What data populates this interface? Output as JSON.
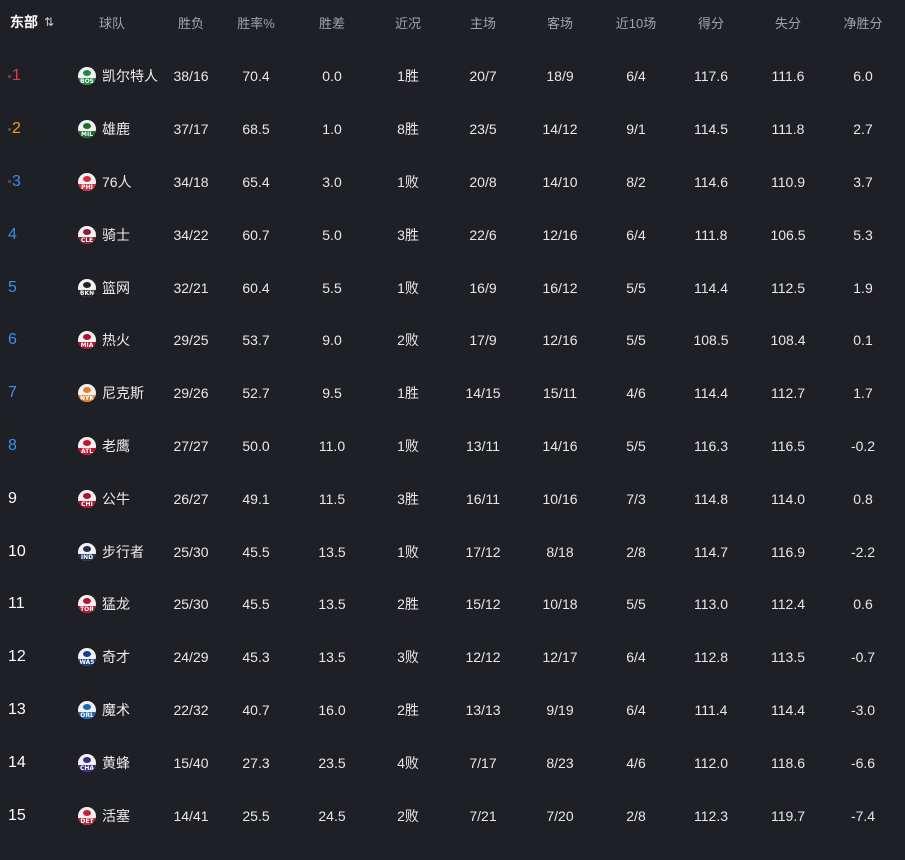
{
  "header": {
    "conference": "东部",
    "sort_icon": "⇅",
    "columns": [
      "球队",
      "胜负",
      "胜率%",
      "胜差",
      "近况",
      "主场",
      "客场",
      "近10场",
      "得分",
      "失分",
      "净胜分"
    ]
  },
  "colors": {
    "rank_top": [
      "#e0404a",
      "#f0a020",
      "#3a8ff0"
    ],
    "rank_playin": "#3a8ff0",
    "rank_other": "#ffffff"
  },
  "teams": [
    {
      "rank": "1",
      "name": "凯尔特人",
      "abbr": "BOS",
      "logo_icon": "celtics-logo-icon",
      "logo_color": "#1e8a45",
      "record": "38/16",
      "pct": "70.4",
      "gb": "0.0",
      "streak": "1胜",
      "home": "20/7",
      "away": "18/9",
      "last10": "6/4",
      "pf": "117.6",
      "pa": "111.6",
      "diff": "6.0"
    },
    {
      "rank": "2",
      "name": "雄鹿",
      "abbr": "MIL",
      "logo_icon": "bucks-logo-icon",
      "logo_color": "#1f6b2e",
      "record": "37/17",
      "pct": "68.5",
      "gb": "1.0",
      "streak": "8胜",
      "home": "23/5",
      "away": "14/12",
      "last10": "9/1",
      "pf": "114.5",
      "pa": "111.8",
      "diff": "2.7"
    },
    {
      "rank": "3",
      "name": "76人",
      "abbr": "PHI",
      "logo_icon": "76ers-logo-icon",
      "logo_color": "#d62b3a",
      "record": "34/18",
      "pct": "65.4",
      "gb": "3.0",
      "streak": "1败",
      "home": "20/8",
      "away": "14/10",
      "last10": "8/2",
      "pf": "114.6",
      "pa": "110.9",
      "diff": "3.7"
    },
    {
      "rank": "4",
      "name": "骑士",
      "abbr": "CLE",
      "logo_icon": "cavaliers-logo-icon",
      "logo_color": "#8a1b3a",
      "record": "34/22",
      "pct": "60.7",
      "gb": "5.0",
      "streak": "3胜",
      "home": "22/6",
      "away": "12/16",
      "last10": "6/4",
      "pf": "111.8",
      "pa": "106.5",
      "diff": "5.3"
    },
    {
      "rank": "5",
      "name": "篮网",
      "abbr": "BKN",
      "logo_icon": "nets-logo-icon",
      "logo_color": "#222222",
      "record": "32/21",
      "pct": "60.4",
      "gb": "5.5",
      "streak": "1败",
      "home": "16/9",
      "away": "16/12",
      "last10": "5/5",
      "pf": "114.4",
      "pa": "112.5",
      "diff": "1.9"
    },
    {
      "rank": "6",
      "name": "热火",
      "abbr": "MIA",
      "logo_icon": "heat-logo-icon",
      "logo_color": "#b8102f",
      "record": "29/25",
      "pct": "53.7",
      "gb": "9.0",
      "streak": "2败",
      "home": "17/9",
      "away": "12/16",
      "last10": "5/5",
      "pf": "108.5",
      "pa": "108.4",
      "diff": "0.1"
    },
    {
      "rank": "7",
      "name": "尼克斯",
      "abbr": "NYK",
      "logo_icon": "knicks-logo-icon",
      "logo_color": "#e2802a",
      "record": "29/26",
      "pct": "52.7",
      "gb": "9.5",
      "streak": "1胜",
      "home": "14/15",
      "away": "15/11",
      "last10": "4/6",
      "pf": "114.4",
      "pa": "112.7",
      "diff": "1.7"
    },
    {
      "rank": "8",
      "name": "老鹰",
      "abbr": "ATL",
      "logo_icon": "hawks-logo-icon",
      "logo_color": "#c8102e",
      "record": "27/27",
      "pct": "50.0",
      "gb": "11.0",
      "streak": "1败",
      "home": "13/11",
      "away": "14/16",
      "last10": "5/5",
      "pf": "116.3",
      "pa": "116.5",
      "diff": "-0.2"
    },
    {
      "rank": "9",
      "name": "公牛",
      "abbr": "CHI",
      "logo_icon": "bulls-logo-icon",
      "logo_color": "#b0102a",
      "record": "26/27",
      "pct": "49.1",
      "gb": "11.5",
      "streak": "3胜",
      "home": "16/11",
      "away": "10/16",
      "last10": "7/3",
      "pf": "114.8",
      "pa": "114.0",
      "diff": "0.8"
    },
    {
      "rank": "10",
      "name": "步行者",
      "abbr": "IND",
      "logo_icon": "pacers-logo-icon",
      "logo_color": "#1d2a5c",
      "record": "25/30",
      "pct": "45.5",
      "gb": "13.5",
      "streak": "1败",
      "home": "17/12",
      "away": "8/18",
      "last10": "2/8",
      "pf": "114.7",
      "pa": "116.9",
      "diff": "-2.2"
    },
    {
      "rank": "11",
      "name": "猛龙",
      "abbr": "TOR",
      "logo_icon": "raptors-logo-icon",
      "logo_color": "#b81230",
      "record": "25/30",
      "pct": "45.5",
      "gb": "13.5",
      "streak": "2胜",
      "home": "15/12",
      "away": "10/18",
      "last10": "5/5",
      "pf": "113.0",
      "pa": "112.4",
      "diff": "0.6"
    },
    {
      "rank": "12",
      "name": "奇才",
      "abbr": "WAS",
      "logo_icon": "wizards-logo-icon",
      "logo_color": "#1b3a8a",
      "record": "24/29",
      "pct": "45.3",
      "gb": "13.5",
      "streak": "3败",
      "home": "12/12",
      "away": "12/17",
      "last10": "6/4",
      "pf": "112.8",
      "pa": "113.5",
      "diff": "-0.7"
    },
    {
      "rank": "13",
      "name": "魔术",
      "abbr": "ORL",
      "logo_icon": "magic-logo-icon",
      "logo_color": "#1a68b8",
      "record": "22/32",
      "pct": "40.7",
      "gb": "16.0",
      "streak": "2胜",
      "home": "13/13",
      "away": "9/19",
      "last10": "6/4",
      "pf": "111.4",
      "pa": "114.4",
      "diff": "-3.0"
    },
    {
      "rank": "14",
      "name": "黄蜂",
      "abbr": "CHA",
      "logo_icon": "hornets-logo-icon",
      "logo_color": "#3a2a8a",
      "record": "15/40",
      "pct": "27.3",
      "gb": "23.5",
      "streak": "4败",
      "home": "7/17",
      "away": "8/23",
      "last10": "4/6",
      "pf": "112.0",
      "pa": "118.6",
      "diff": "-6.6"
    },
    {
      "rank": "15",
      "name": "活塞",
      "abbr": "DET",
      "logo_icon": "pistons-logo-icon",
      "logo_color": "#c8203a",
      "record": "14/41",
      "pct": "25.5",
      "gb": "24.5",
      "streak": "2败",
      "home": "7/21",
      "away": "7/20",
      "last10": "2/8",
      "pf": "112.3",
      "pa": "119.7",
      "diff": "-7.4"
    }
  ]
}
